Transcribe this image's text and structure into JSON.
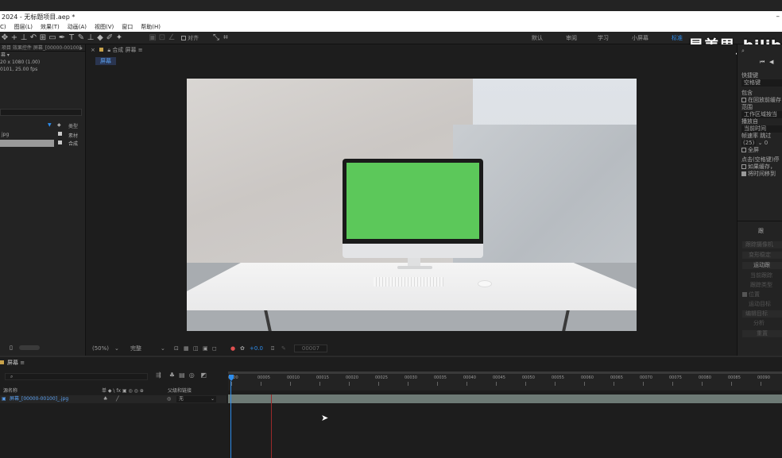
{
  "window": {
    "title": "2024 - 无标题项目.aep *"
  },
  "menu": [
    "C)",
    "图层(L)",
    "效果(T)",
    "动画(A)",
    "视图(V)",
    "窗口",
    "帮助(H)"
  ],
  "toolbar": {
    "align_label": "对齐"
  },
  "workspaces": [
    "默认",
    "审阅",
    "学习",
    "小屏幕",
    "标准"
  ],
  "watermark": "星美男_bilib",
  "project_panel": {
    "header": "项目  效果控件 屏幕_[00000-00100].",
    "item_name": "幕 ▾",
    "item_size": "20 x 1080 (1.00)",
    "item_duration": "0101, 25.00 fps",
    "col_type": "类型",
    "col_tag": "标",
    "rows": [
      {
        "name": "jpg",
        "type": "素材"
      },
      {
        "name": "",
        "type": "合成"
      }
    ],
    "bpc": "8"
  },
  "comp_panel": {
    "tab_label": "合成 屏幕",
    "crumb": "屏幕",
    "zoom": "(50%)",
    "quality": "完整",
    "exposure": "+0.0",
    "timecode": "00007"
  },
  "preview_panel": {
    "section1": "快捷键",
    "shortcut": "空格键",
    "include": "包含",
    "cache_label": "在回放前缓存",
    "range_label": "范围",
    "range_value": "工作区域按当",
    "play_from": "播放自",
    "play_from_value": "当前时间",
    "frame_rate_label": "帧速率",
    "skip_label": "跳过",
    "frame_rate_value": "(25)",
    "skip_value": "0",
    "fullscreen": "全屏",
    "click_label": "点击(空格键)停",
    "if_cached": "如果缓存，",
    "move_time": "将时间移到",
    "tracker_title": "跟",
    "tracker_buttons": [
      "跟踪摄像机",
      "变形稳定",
      "运动跟",
      "当前跟踪",
      "跟踪类型"
    ],
    "position": "位置",
    "motion_target": "运动目标",
    "edit_target": "编辑目标",
    "analyze": "分析",
    "reset": "重置"
  },
  "timeline": {
    "tab_label": "屏幕",
    "search_placeholder": "",
    "col_source": "源名称",
    "col_switches": "单 ◆ \\ fx ▣ ◎ ◎ ⊕",
    "col_parent": "父级和链接",
    "layer_num": "1",
    "layer_name": "屏幕_[00000-00100]_.jpg",
    "parent_value": "无",
    "ruler_ticks": [
      "0000",
      "00005",
      "00010",
      "00015",
      "00020",
      "00025",
      "00030",
      "00035",
      "00040",
      "00045",
      "00050",
      "00055",
      "00060",
      "00065",
      "00070",
      "00075",
      "00080",
      "00085",
      "00090"
    ]
  },
  "colors": {
    "accent": "#2d8ceb",
    "green_screen": "#5cc85a"
  }
}
